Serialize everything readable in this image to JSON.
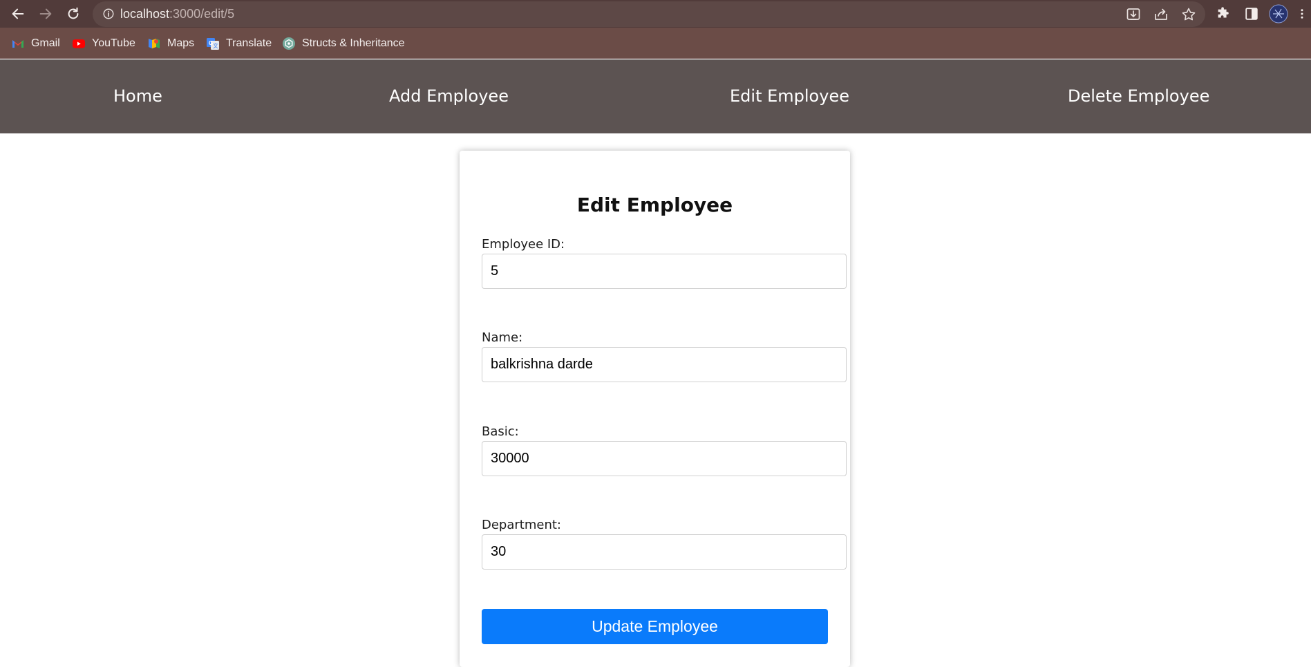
{
  "browser": {
    "url_host": "localhost",
    "url_path": ":3000/edit/5",
    "bookmarks": [
      {
        "label": "Gmail",
        "icon": "gmail-icon"
      },
      {
        "label": "YouTube",
        "icon": "youtube-icon"
      },
      {
        "label": "Maps",
        "icon": "maps-icon"
      },
      {
        "label": "Translate",
        "icon": "translate-icon"
      },
      {
        "label": "Structs & Inheritance",
        "icon": "chatgpt-icon"
      }
    ]
  },
  "nav": {
    "items": [
      "Home",
      "Add Employee",
      "Edit Employee",
      "Delete Employee"
    ]
  },
  "form": {
    "title": "Edit Employee",
    "fields": [
      {
        "label": "Employee ID:",
        "value": "5"
      },
      {
        "label": "Name:",
        "value": "balkrishna darde"
      },
      {
        "label": "Basic:",
        "value": "30000"
      },
      {
        "label": "Department:",
        "value": "30"
      }
    ],
    "submit_label": "Update Employee"
  },
  "colors": {
    "chrome_bg": "#513b3a",
    "bookmarks_bg": "#6b4c47",
    "nav_bg": "#5c5352",
    "submit_bg": "#0a7bfb"
  }
}
